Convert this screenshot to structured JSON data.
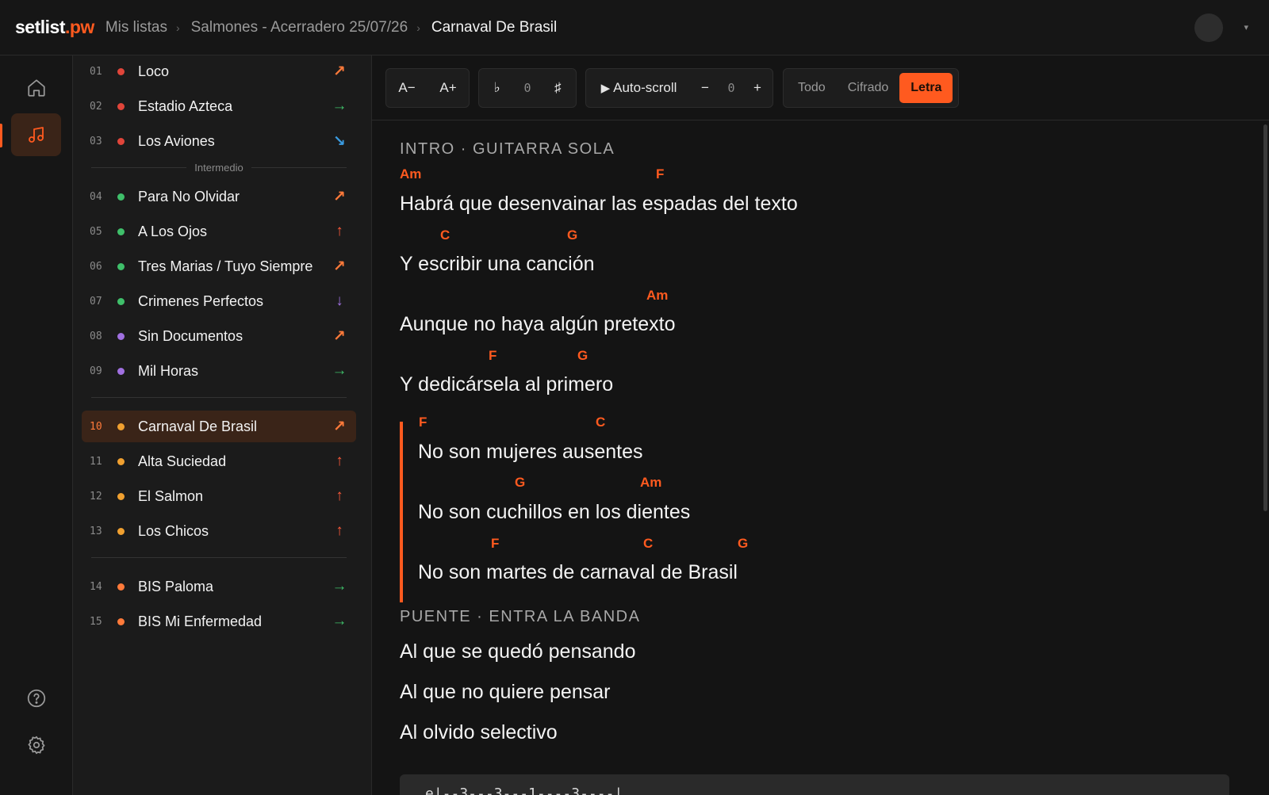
{
  "header": {
    "logo_main": "setlist",
    "logo_dot": ".",
    "logo_tld": "pw",
    "breadcrumb": [
      "Mis listas",
      "Salmones - Acerradero 25/07/26",
      "Carnaval De Brasil"
    ],
    "separator": "›",
    "avatar_caret": "▾"
  },
  "rail": {
    "items": [
      {
        "icon": "home-icon",
        "active": false
      },
      {
        "icon": "music-note-icon",
        "active": true
      },
      {
        "icon": "help-icon",
        "active": false
      },
      {
        "icon": "settings-icon",
        "active": false
      }
    ]
  },
  "setlist": {
    "songs": [
      {
        "num": "01",
        "title": "Loco",
        "dot": "#e0453a",
        "arrow": "↗",
        "arrow_color": "#ff7a3a"
      },
      {
        "num": "02",
        "title": "Estadio Azteca",
        "dot": "#e0453a",
        "arrow": "→",
        "arrow_color": "#3fbf6a"
      },
      {
        "num": "03",
        "title": "Los Aviones",
        "dot": "#e0453a",
        "arrow": "↘",
        "arrow_color": "#3a9be0"
      },
      {
        "num": "04",
        "title": "Para No Olvidar",
        "dot": "#3fbf6a",
        "arrow": "↗",
        "arrow_color": "#ff7a3a"
      },
      {
        "num": "05",
        "title": "A Los Ojos",
        "dot": "#3fbf6a",
        "arrow": "↑",
        "arrow_color": "#ff5a3a"
      },
      {
        "num": "06",
        "title": "Tres Marias / Tuyo Siempre",
        "dot": "#3fbf6a",
        "arrow": "↗",
        "arrow_color": "#ff7a3a"
      },
      {
        "num": "07",
        "title": "Crimenes Perfectos",
        "dot": "#3fbf6a",
        "arrow": "↓",
        "arrow_color": "#a070e0"
      },
      {
        "num": "08",
        "title": "Sin Documentos",
        "dot": "#a070e0",
        "arrow": "↗",
        "arrow_color": "#ff7a3a"
      },
      {
        "num": "09",
        "title": "Mil Horas",
        "dot": "#a070e0",
        "arrow": "→",
        "arrow_color": "#3fbf6a"
      },
      {
        "num": "10",
        "title": "Carnaval De Brasil",
        "dot": "#f0a030",
        "arrow": "↗",
        "arrow_color": "#ff7a3a",
        "active": true
      },
      {
        "num": "11",
        "title": "Alta Suciedad",
        "dot": "#f0a030",
        "arrow": "↑",
        "arrow_color": "#ff5a3a"
      },
      {
        "num": "12",
        "title": "El Salmon",
        "dot": "#f0a030",
        "arrow": "↑",
        "arrow_color": "#ff5a3a"
      },
      {
        "num": "13",
        "title": "Los Chicos",
        "dot": "#f0a030",
        "arrow": "↑",
        "arrow_color": "#ff5a3a"
      },
      {
        "num": "14",
        "title": "BIS Paloma",
        "dot": "#ff7a3a",
        "arrow": "→",
        "arrow_color": "#3fbf6a"
      },
      {
        "num": "15",
        "title": "BIS Mi Enfermedad",
        "dot": "#ff7a3a",
        "arrow": "→",
        "arrow_color": "#3fbf6a"
      }
    ],
    "intermission_label": "Intermedio"
  },
  "toolbar": {
    "font_smaller": "A−",
    "font_larger": "A+",
    "flat": "♭",
    "transpose_value": "0",
    "sharp": "♯",
    "autoscroll_label": "Auto-scroll",
    "autoscroll_play": "▶",
    "speed_minus": "−",
    "speed_value": "0",
    "speed_plus": "+",
    "view_modes": [
      "Todo",
      "Cifrado",
      "Letra"
    ],
    "active_view": "Letra"
  },
  "sheet": {
    "intro_title": "INTRO · GUITARRA SOLA",
    "intro_chords": [
      "Am",
      "F",
      "C",
      "G",
      "Am",
      "F",
      "G"
    ],
    "intro_lines": [
      "Habrá que desenvainar las espadas del texto",
      "Y escribir una canción",
      "Aunque no haya algún pretexto",
      "Y dedicársela al primero"
    ],
    "chorus_chords": [
      "F",
      "C",
      "G",
      "Am",
      "F",
      "C",
      "G"
    ],
    "chorus_lines": [
      "No son mujeres ausentes",
      "No son cuchillos en los dientes",
      "No son martes de carnaval de Brasil"
    ],
    "bridge_title": "PUENTE · ENTRA LA BANDA",
    "bridge_lines": [
      "Al que se quedó pensando",
      "Al que no quiere pensar",
      "Al olvido selectivo"
    ],
    "tab_preview": "e|--3---3---1----3----|"
  }
}
